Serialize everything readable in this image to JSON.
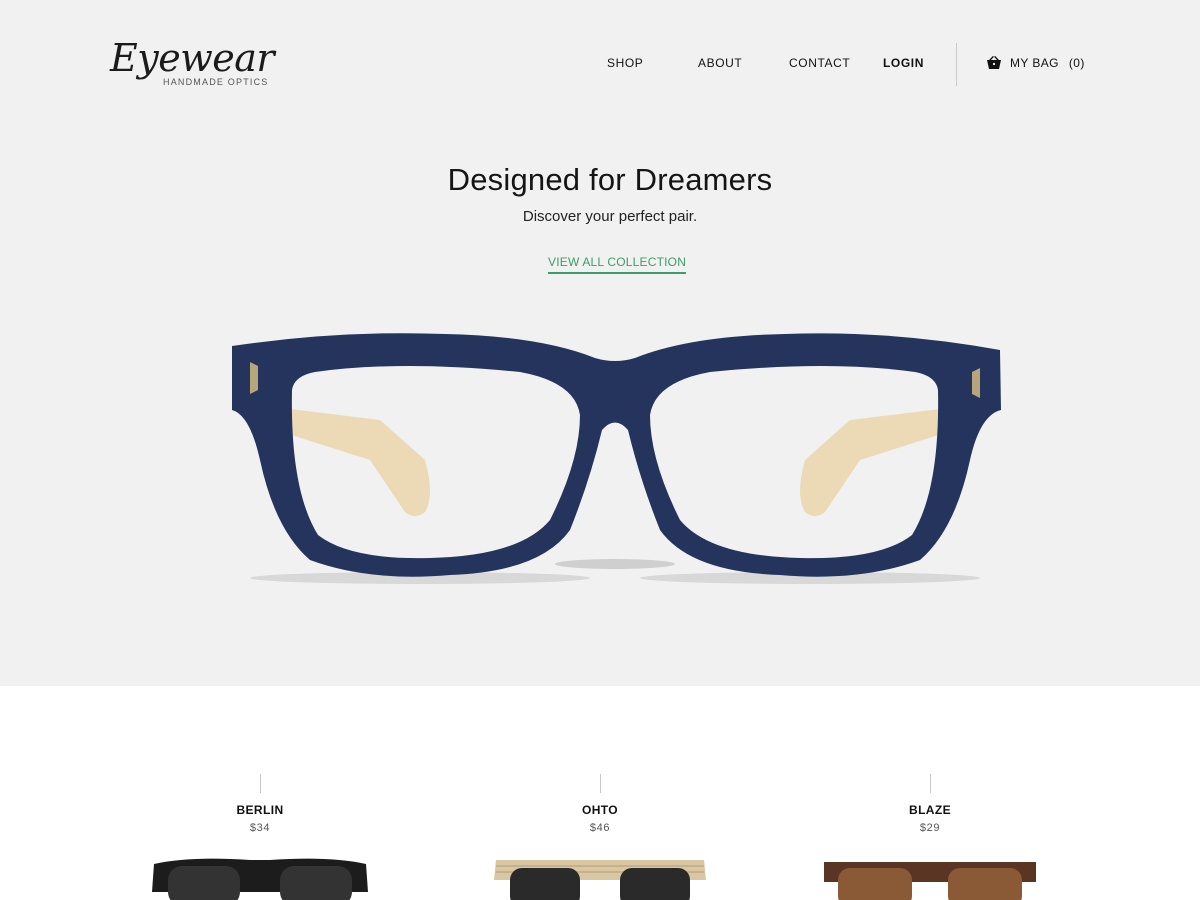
{
  "header": {
    "logo_script": "Eyewear",
    "logo_tagline": "HANDMADE OPTICS",
    "nav": {
      "shop": "SHOP",
      "about": "ABOUT",
      "contact": "CONTACT",
      "login": "LOGIN"
    },
    "bag": {
      "label": "MY BAG",
      "count": "(0)",
      "icon": "basket-icon"
    }
  },
  "hero": {
    "title": "Designed for Dreamers",
    "subtitle": "Discover your perfect pair.",
    "cta": "VIEW ALL COLLECTION",
    "cta_color": "#3a9e6a",
    "background": "#f1f1f1",
    "frame_color": "#24345c",
    "temple_color": "#ecd9b6"
  },
  "products": [
    {
      "name": "BERLIN",
      "price": "$34"
    },
    {
      "name": "OHTO",
      "price": "$46"
    },
    {
      "name": "BLAZE",
      "price": "$29"
    }
  ]
}
